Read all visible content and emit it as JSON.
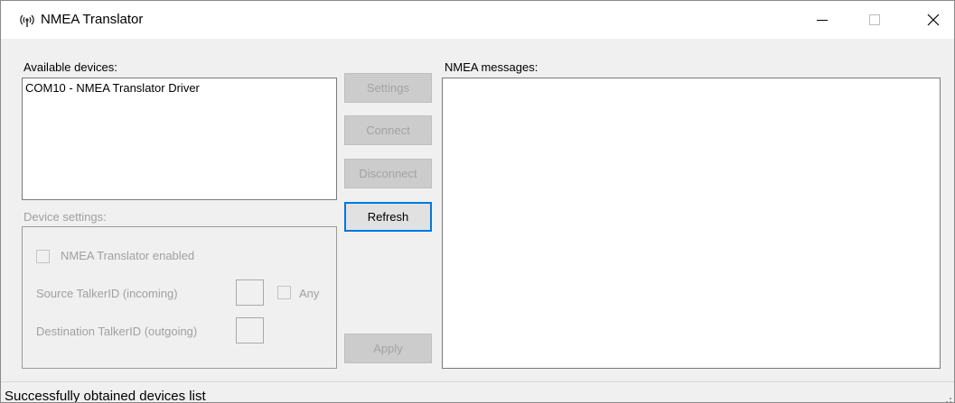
{
  "window": {
    "title": "NMEA Translator",
    "app_icon": "broadcast-antenna-icon",
    "controls": [
      "minimize-icon",
      "maximize-icon",
      "close-icon"
    ]
  },
  "devices": {
    "label": "Available devices:",
    "items": [
      "COM10 - NMEA Translator Driver"
    ]
  },
  "buttons": {
    "settings": "Settings",
    "connect": "Connect",
    "disconnect": "Disconnect",
    "refresh": "Refresh",
    "apply": "Apply"
  },
  "device_settings": {
    "label": "Device settings:",
    "enabled_label": "NMEA Translator enabled",
    "source_label": "Source TalkerID (incoming)",
    "any_label": "Any",
    "destination_label": "Destination TalkerID (outgoing)",
    "source_value": "",
    "destination_value": ""
  },
  "messages": {
    "label": "NMEA messages:"
  },
  "status": {
    "text": "Successfully obtained devices list"
  },
  "colors": {
    "focus_border": "#0078d7",
    "disabled_text": "#a0a0a0",
    "window_bg": "#f0f0f0"
  }
}
